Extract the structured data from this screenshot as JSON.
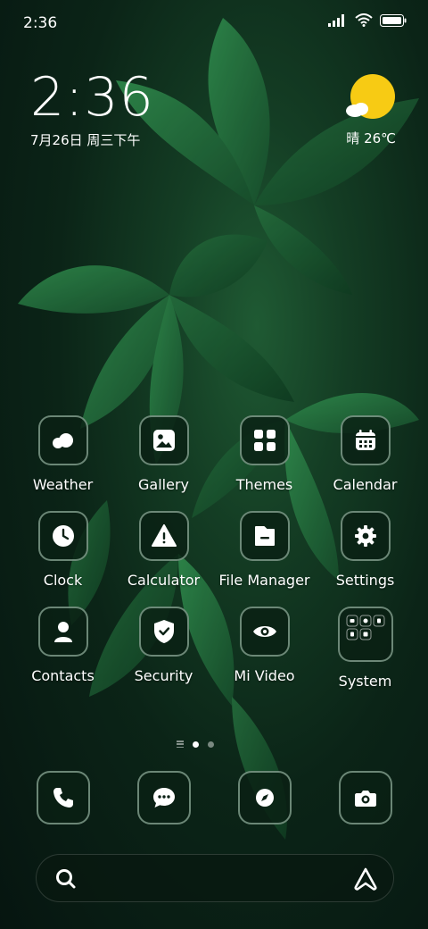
{
  "status_bar": {
    "time": "2:36",
    "icons": [
      "signal-icon",
      "wifi-icon",
      "battery-icon"
    ]
  },
  "clock_widget": {
    "time": "2:36",
    "date": "7月26日 周三下午"
  },
  "weather_widget": {
    "icon": "sun-cloud-icon",
    "condition_temp": "晴 26℃",
    "sun_color": "#F7CB14"
  },
  "apps": [
    {
      "label": "Weather",
      "icon": "weather-icon"
    },
    {
      "label": "Gallery",
      "icon": "gallery-icon"
    },
    {
      "label": "Themes",
      "icon": "themes-icon"
    },
    {
      "label": "Calendar",
      "icon": "calendar-icon"
    },
    {
      "label": "Clock",
      "icon": "clock-icon"
    },
    {
      "label": "Calculator",
      "icon": "calculator-icon"
    },
    {
      "label": "File Manager",
      "icon": "file-manager-icon"
    },
    {
      "label": "Settings",
      "icon": "settings-icon"
    },
    {
      "label": "Contacts",
      "icon": "contacts-icon"
    },
    {
      "label": "Security",
      "icon": "security-icon"
    },
    {
      "label": "Mi Video",
      "icon": "mi-video-icon"
    },
    {
      "label": "System",
      "icon": "system-folder-icon"
    }
  ],
  "page_indicator": {
    "pages": 2,
    "current": 1
  },
  "dock": [
    "phone-icon",
    "messages-icon",
    "browser-icon",
    "camera-icon"
  ],
  "search_bar": {
    "left_icon": "search-icon",
    "right_icon": "assistant-icon"
  },
  "colors": {
    "tile_bg": "#0a2014",
    "tile_border": "#bedcc8",
    "accent_yellow": "#F7CB14"
  }
}
